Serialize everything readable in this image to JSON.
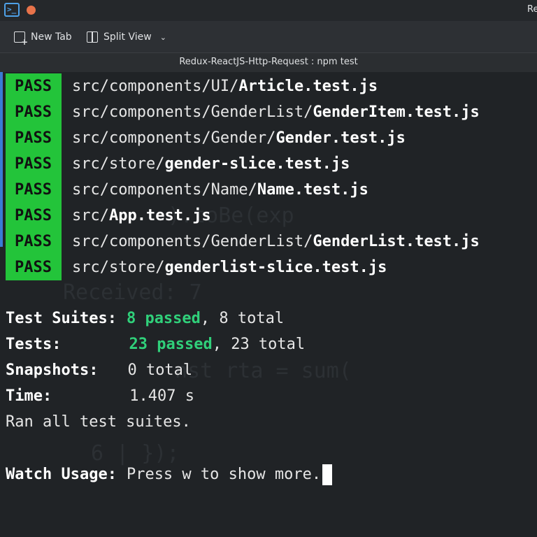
{
  "window": {
    "title": "Re"
  },
  "toolbar": {
    "new_tab": "New Tab",
    "split_view": "Split View"
  },
  "tab": {
    "title": "Redux-ReactJS-Http-Request : npm test"
  },
  "results": [
    {
      "status": "PASS",
      "dir": "src/components/UI/",
      "file": "Article.test.js"
    },
    {
      "status": "PASS",
      "dir": "src/components/GenderList/",
      "file": "GenderItem.test.js"
    },
    {
      "status": "PASS",
      "dir": "src/components/Gender/",
      "file": "Gender.test.js"
    },
    {
      "status": "PASS",
      "dir": "src/store/",
      "file": "gender-slice.test.js"
    },
    {
      "status": "PASS",
      "dir": "src/components/Name/",
      "file": "Name.test.js"
    },
    {
      "status": "PASS",
      "dir": "src/",
      "file": "App.test.js"
    },
    {
      "status": "PASS",
      "dir": "src/components/GenderList/",
      "file": "GenderList.test.js"
    },
    {
      "status": "PASS",
      "dir": "src/store/",
      "file": "genderlist-slice.test.js"
    }
  ],
  "summary": {
    "suites_label": "Test Suites:",
    "suites_passed": "8 passed",
    "suites_total": ", 8 total",
    "tests_label": "Tests:",
    "tests_passed": "23 passed",
    "tests_total": ", 23 total",
    "snapshots_label": "Snapshots:",
    "snapshots_value": "0 total",
    "time_label": "Time:",
    "time_value": "1.407 s",
    "ran_all": "Ran all test suites.",
    "watch_label": "Watch Usage:",
    "watch_value": "Press w to show more."
  },
  "colors": {
    "pass_bg": "#23c43a",
    "passed_text": "#30d07a",
    "accent": "#3a7bd5"
  }
}
